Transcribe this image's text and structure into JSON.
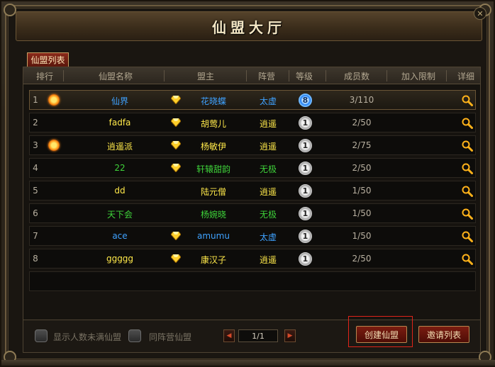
{
  "window": {
    "title": "仙盟大厅",
    "close_symbol": "✕"
  },
  "tab": {
    "label": "仙盟列表"
  },
  "columns": [
    "排行",
    "仙盟名称",
    "盟主",
    "阵营",
    "等级",
    "成员数",
    "加入限制",
    "详细"
  ],
  "rows": [
    {
      "rank": "1",
      "badge": "sun-icon",
      "name": "仙界",
      "name_color": "#3fa2ff",
      "diamond": true,
      "leader": "花晓蝶",
      "leader_color": "#3fa2ff",
      "faction": "太虚",
      "faction_color": "#3fa2ff",
      "level": "8",
      "level_style": "blue",
      "members": "3/110",
      "limit": "",
      "selected": true
    },
    {
      "rank": "2",
      "badge": "",
      "name": "fadfa",
      "name_color": "#ffe94a",
      "diamond": true,
      "leader": "胡莺儿",
      "leader_color": "#ffe94a",
      "faction": "逍遥",
      "faction_color": "#ffe94a",
      "level": "1",
      "level_style": "white",
      "members": "2/50",
      "limit": "",
      "selected": false
    },
    {
      "rank": "3",
      "badge": "sun-icon",
      "name": "逍遥派",
      "name_color": "#ffe94a",
      "diamond": true,
      "leader": "杨敏伊",
      "leader_color": "#ffe94a",
      "faction": "逍遥",
      "faction_color": "#ffe94a",
      "level": "1",
      "level_style": "white",
      "members": "2/75",
      "limit": "",
      "selected": false
    },
    {
      "rank": "4",
      "badge": "",
      "name": "22",
      "name_color": "#3fd23a",
      "diamond": true,
      "leader": "轩辕甜韵",
      "leader_color": "#3fd23a",
      "faction": "无极",
      "faction_color": "#3fd23a",
      "level": "1",
      "level_style": "white",
      "members": "2/50",
      "limit": "",
      "selected": false
    },
    {
      "rank": "5",
      "badge": "",
      "name": "dd",
      "name_color": "#ffe94a",
      "diamond": false,
      "leader": "陆元僧",
      "leader_color": "#ffe94a",
      "faction": "逍遥",
      "faction_color": "#ffe94a",
      "level": "1",
      "level_style": "white",
      "members": "1/50",
      "limit": "",
      "selected": false
    },
    {
      "rank": "6",
      "badge": "",
      "name": "天下会",
      "name_color": "#3fd23a",
      "diamond": false,
      "leader": "杨婉晓",
      "leader_color": "#3fd23a",
      "faction": "无极",
      "faction_color": "#3fd23a",
      "level": "1",
      "level_style": "white",
      "members": "1/50",
      "limit": "",
      "selected": false
    },
    {
      "rank": "7",
      "badge": "",
      "name": "ace",
      "name_color": "#3fa2ff",
      "diamond": true,
      "leader": "amumu",
      "leader_color": "#3fa2ff",
      "faction": "太虚",
      "faction_color": "#3fa2ff",
      "level": "1",
      "level_style": "white",
      "members": "1/50",
      "limit": "",
      "selected": false
    },
    {
      "rank": "8",
      "badge": "",
      "name": "ggggg",
      "name_color": "#ffe94a",
      "diamond": true,
      "leader": "康汉子",
      "leader_color": "#ffe94a",
      "faction": "逍遥",
      "faction_color": "#ffe94a",
      "level": "1",
      "level_style": "white",
      "members": "2/50",
      "limit": "",
      "selected": false
    }
  ],
  "footer": {
    "checkbox_not_full": "显示人数未满仙盟",
    "checkbox_same_faction": "同阵营仙盟",
    "prev_symbol": "◀",
    "next_symbol": "▶",
    "page": "1/1",
    "create_button": "创建仙盟",
    "invite_button": "邀请列表"
  }
}
